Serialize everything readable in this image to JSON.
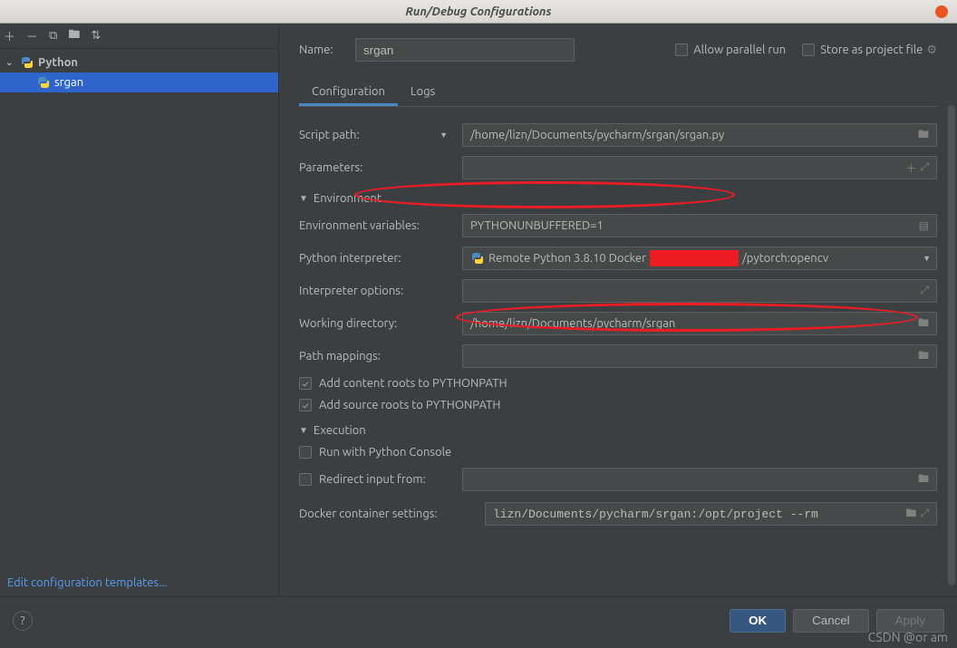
{
  "window": {
    "title": "Run/Debug Configurations"
  },
  "sidebar": {
    "root": "Python",
    "items": [
      "srgan"
    ],
    "edit_templates": "Edit configuration templates..."
  },
  "top": {
    "name_label": "Name:",
    "name_value": "srgan",
    "allow_parallel": "Allow parallel run",
    "store_as_project": "Store as project file"
  },
  "tabs": {
    "configuration": "Configuration",
    "logs": "Logs"
  },
  "form": {
    "script_path_label": "Script path:",
    "script_path_value": "/home/lizn/Documents/pycharm/srgan/srgan.py",
    "parameters_label": "Parameters:",
    "parameters_value": "",
    "environment_header": "Environment",
    "env_vars_label": "Environment variables:",
    "env_vars_value": "PYTHONUNBUFFERED=1",
    "py_interpreter_label": "Python interpreter:",
    "py_interpreter_prefix": "Remote Python 3.8.10 Docker",
    "py_interpreter_suffix": "/pytorch:opencv",
    "interp_options_label": "Interpreter options:",
    "interp_options_value": "",
    "working_dir_label": "Working directory:",
    "working_dir_value": "/home/lizn/Documents/pycharm/srgan",
    "path_mappings_label": "Path mappings:",
    "path_mappings_value": "",
    "add_content_roots": "Add content roots to PYTHONPATH",
    "add_source_roots": "Add source roots to PYTHONPATH",
    "execution_header": "Execution",
    "run_with_console": "Run with Python Console",
    "redirect_input_label": "Redirect input from:",
    "redirect_input_value": "",
    "docker_settings_label": "Docker container settings:",
    "docker_settings_value": "lizn/Documents/pycharm/srgan:/opt/project --rm"
  },
  "buttons": {
    "ok": "OK",
    "cancel": "Cancel",
    "apply": "Apply"
  },
  "watermark": "CSDN @or am"
}
